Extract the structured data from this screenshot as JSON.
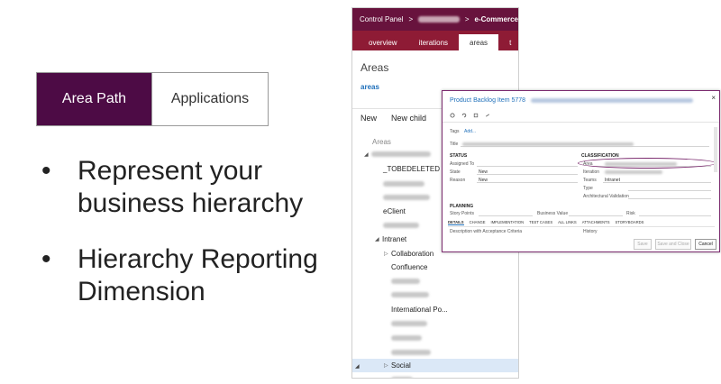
{
  "slide": {
    "tabs": [
      {
        "label": "Area Path",
        "active": true
      },
      {
        "label": "Applications",
        "active": false
      }
    ],
    "bullets": [
      "Represent your business hierarchy",
      "Hierarchy Reporting Dimension"
    ],
    "bullet_glyph": "•",
    "colors": {
      "accent": "#4d0b45",
      "panel_header": "#68133d",
      "panel_nav": "#8e1b35",
      "link": "#1e6fba"
    }
  },
  "control_panel": {
    "breadcrumb": {
      "root": "Control Panel",
      "sep": ">",
      "leaf": "e-Commerce"
    },
    "tabs": [
      "overview",
      "iterations",
      "areas",
      "t"
    ],
    "selected_tab": "areas",
    "heading": "Areas",
    "link": "areas",
    "toolbar": {
      "new": "New",
      "new_child": "New child"
    },
    "tree_header": "Areas",
    "tree": {
      "tobedeleted": "_TOBEDELETED",
      "eclient": "eClient",
      "intranet": "Intranet",
      "collaboration": "Collaboration",
      "confluence": "Confluence",
      "international": "International Po...",
      "social": "Social"
    },
    "expander_glyphs": {
      "expanded": "◢",
      "collapsed": "▷"
    }
  },
  "work_item": {
    "title": "Product Backlog Item 5778",
    "close": "×",
    "tags_label": "Tags",
    "tags_add": "Add...",
    "title_label": "Title",
    "status_header": "STATUS",
    "assigned_to_label": "Assigned To",
    "state_label": "State",
    "state_value": "New",
    "reason_label": "Reason",
    "reason_value": "New",
    "classification_header": "CLASSIFICATION",
    "area_label": "Area",
    "iteration_label": "Iteration",
    "teams_label": "Teams",
    "teams_value": "Intranet",
    "type_label": "Type",
    "arch_label": "Architectural Validation",
    "planning_header": "PLANNING",
    "story_points_label": "Story Points",
    "business_value_label": "Business Value",
    "risk_label": "Risk",
    "tabs": [
      "DETAILS",
      "CHANGE",
      "IMPLEMENTATION",
      "TEST CASES",
      "ALL LINKS",
      "ATTACHMENTS",
      "STORYBOARDS"
    ],
    "description_label": "Description with Acceptance Criteria",
    "history_label": "History",
    "buttons": {
      "save": "Save",
      "save_close": "Save and Close",
      "cancel": "Cancel"
    }
  }
}
